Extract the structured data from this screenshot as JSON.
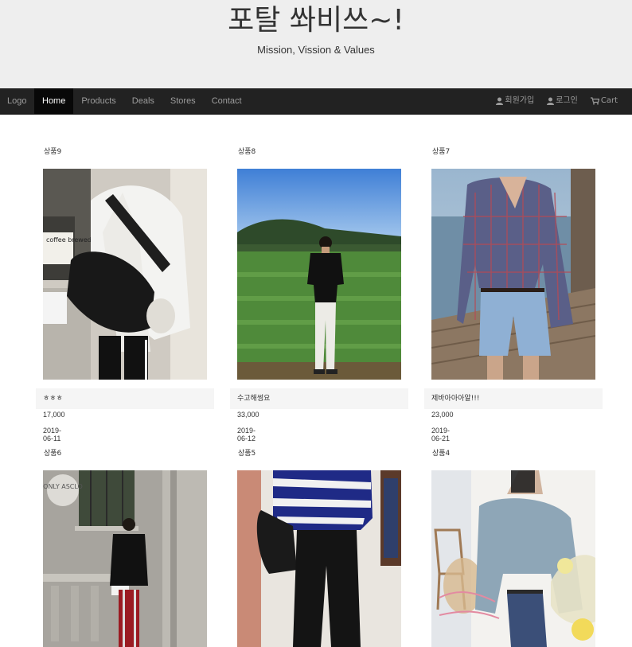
{
  "header": {
    "title": "포탈 쏴비쓰~!",
    "subtitle": "Mission, Vission & Values"
  },
  "nav": {
    "brand": "Logo",
    "tabs": [
      {
        "label": "Home",
        "active": true
      },
      {
        "label": "Products",
        "active": false
      },
      {
        "label": "Deals",
        "active": false
      },
      {
        "label": "Stores",
        "active": false
      },
      {
        "label": "Contact",
        "active": false
      }
    ],
    "right": [
      {
        "icon": "user-icon",
        "label": "회원가입"
      },
      {
        "icon": "user-icon",
        "label": "로그인"
      },
      {
        "icon": "cart-icon",
        "label": "Cart"
      }
    ]
  },
  "products": [
    {
      "name": "상품9",
      "desc": "ㅎㅎㅎ",
      "price": "17,000",
      "date": "2019-06-11"
    },
    {
      "name": "상품8",
      "desc": "수고해썽요",
      "price": "33,000",
      "date": "2019-06-12"
    },
    {
      "name": "상품7",
      "desc": "제바아아아알!!!",
      "price": "23,000",
      "date": "2019-06-21"
    },
    {
      "name": "상품6"
    },
    {
      "name": "상품5"
    },
    {
      "name": "상품4"
    }
  ],
  "image_text": {
    "coffee_sign": "coffee brewed",
    "badge": "ONLY ASCLO"
  }
}
